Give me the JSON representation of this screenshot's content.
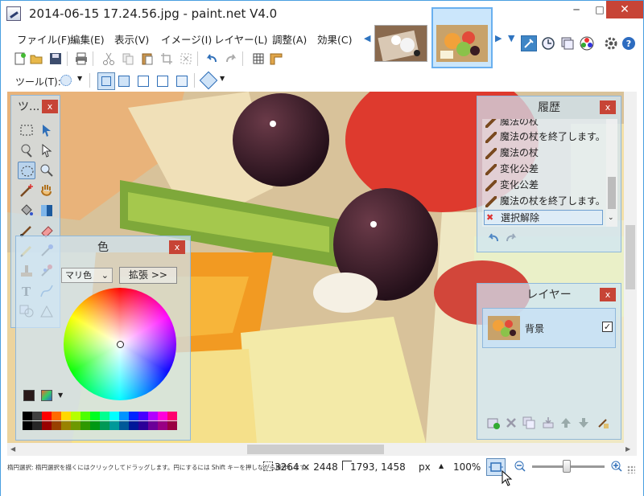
{
  "window": {
    "title": "2014-06-15 17.24.56.jpg - paint.net V4.0",
    "min_label": "─",
    "max_label": "□",
    "close_label": "✕"
  },
  "menu": {
    "items": [
      "ファイル(F)",
      "編集(E)",
      "表示(V)",
      "イメージ(I)",
      "レイヤー(L)",
      "調整(A)",
      "効果(C)"
    ]
  },
  "toolbar": {
    "tool_label": "ツール(T):",
    "icons": [
      "new-icon",
      "open-icon",
      "save-icon",
      "print-icon",
      "cut-icon",
      "copy-icon",
      "paste-icon",
      "crop-icon",
      "deselect-icon",
      "undo-icon",
      "redo-icon",
      "grid-icon",
      "ruler-icon"
    ]
  },
  "thumbnail_bar": {
    "items": [
      "image-thumbnail-1",
      "image-thumbnail-2"
    ],
    "selected_index": 1,
    "right_icons": [
      "tools-window-icon",
      "history-window-icon",
      "layers-window-icon",
      "colors-window-icon",
      "settings-icon",
      "help-icon"
    ]
  },
  "tools_panel": {
    "title": "ツ...",
    "close_label": "x",
    "tools": [
      "rectangle-select",
      "move-selection",
      "zoom",
      "move-selected",
      "ellipse-select",
      "zoom-tool",
      "magic-wand",
      "pan",
      "paint-bucket",
      "gradient",
      "paintbrush",
      "eraser",
      "pencil",
      "color-picker",
      "clone-stamp",
      "recolor",
      "text",
      "line-curve",
      "shapes",
      "shapes-2"
    ],
    "selected": "ellipse-select"
  },
  "colors_panel": {
    "title": "色",
    "close_label": "x",
    "mode_value": "マリ色",
    "expand_label": "拡張 >>",
    "primary_color": "#2a1a1a",
    "palette": [
      "#000000",
      "#404040",
      "#ff0000",
      "#ff6a00",
      "#ffd800",
      "#b6ff00",
      "#4cff00",
      "#00ff21",
      "#00ff90",
      "#00ffff",
      "#0094ff",
      "#0026ff",
      "#4800ff",
      "#b200ff",
      "#ff00dc",
      "#ff006e"
    ]
  },
  "history_panel": {
    "title": "履歴",
    "close_label": "x",
    "items": [
      "魔法の杖",
      "魔法の杖を終了します。",
      "魔法の杖",
      "変化公差",
      "変化公差",
      "魔法の杖を終了します。",
      "選択解除"
    ],
    "selected_index": 6
  },
  "layers_panel": {
    "title": "レイヤー",
    "close_label": "x",
    "layers": [
      {
        "name": "背景",
        "visible": true
      }
    ]
  },
  "status": {
    "hint": "楕円選択: 楕円選択を描くにはクリックしてドラッグします。円にするには Shift キーを押しながら操作します。",
    "size": "3264 × 2448",
    "coords": "1793, 1458",
    "unit": "px",
    "zoom": "100%"
  },
  "colors": {
    "accent": "#4aa0e0",
    "close": "#c74436"
  }
}
